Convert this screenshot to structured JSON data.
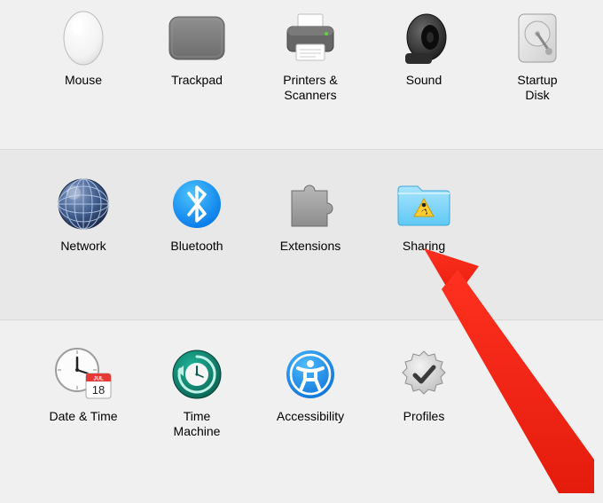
{
  "rows": [
    [
      {
        "id": "mouse",
        "label": "Mouse"
      },
      {
        "id": "trackpad",
        "label": "Trackpad"
      },
      {
        "id": "printers",
        "label": "Printers &\nScanners"
      },
      {
        "id": "sound",
        "label": "Sound"
      },
      {
        "id": "startup",
        "label": "Startup\nDisk"
      }
    ],
    [
      {
        "id": "network",
        "label": "Network"
      },
      {
        "id": "bluetooth",
        "label": "Bluetooth"
      },
      {
        "id": "extensions",
        "label": "Extensions"
      },
      {
        "id": "sharing",
        "label": "Sharing"
      }
    ],
    [
      {
        "id": "datetime",
        "label": "Date & Time"
      },
      {
        "id": "timemachine",
        "label": "Time\nMachine"
      },
      {
        "id": "accessibility",
        "label": "Accessibility"
      },
      {
        "id": "profiles",
        "label": "Profiles"
      }
    ]
  ],
  "calendar": {
    "month": "JUL",
    "day": "18"
  }
}
